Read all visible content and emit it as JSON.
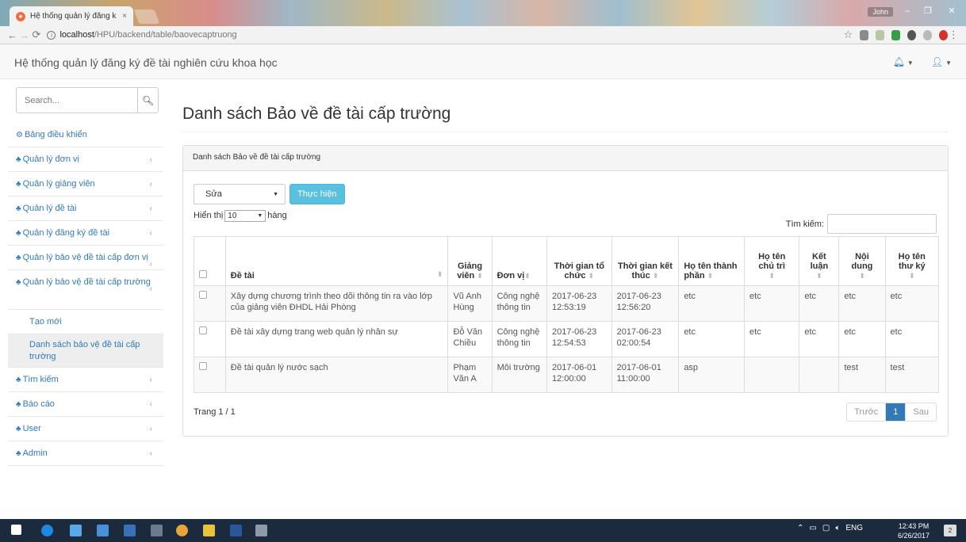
{
  "browser": {
    "tab_title": "Hệ thống quản lý đăng k",
    "tab_close": "×",
    "url_host": "localhost",
    "url_path": "/HPU/backend/table/baovecaptruong",
    "window_user": "John"
  },
  "navbar": {
    "brand": "Hệ thống quản lý đăng ký đề tài nghiên cứu khoa học"
  },
  "sidebar": {
    "search_placeholder": "Search...",
    "dashboard": "Bảng điều khiển",
    "items_top": [
      "Quản lý đơn vị",
      "Quản lý giảng viên",
      "Quản lý đề tài",
      "Quản lý đăng ký đề tài",
      "Quản lý bảo vệ đề tài cấp đơn vị"
    ],
    "current_group": "Quản lý bảo vệ đề tài cấp trường",
    "sub_create": "Tạo mới",
    "sub_list": "Danh sách bảo vệ đề tài cấp trường",
    "items_bottom": [
      "Tìm kiếm",
      "Báo cáo",
      "User",
      "Admin"
    ]
  },
  "main": {
    "page_title": "Danh sách Bảo về đề tài cấp trường",
    "panel_heading": "Danh sách Bảo về đề tài cấp trường",
    "action_selected": "Sửa",
    "execute_button": "Thực hiện",
    "show_label": "Hiển thị",
    "page_length": "10",
    "rows_label": "hàng",
    "search_label": "Tìm kiếm:",
    "page_info": "Trang 1 / 1",
    "pager": {
      "prev": "Trước",
      "current": "1",
      "next": "Sau"
    }
  },
  "table": {
    "headers": [
      "Đề tài",
      "Giảng viên",
      "Đơn vị",
      "Thời gian tổ chức",
      "Thời gian kết thúc",
      "Họ tên thành phần",
      "Họ tên chủ trì",
      "Kết luận",
      "Nội dung",
      "Họ tên thư ký"
    ],
    "rows": [
      [
        "Xây dựng chương trình theo dõi thông tin ra vào lớp của giảng viên ĐHDL Hải Phòng",
        "Vũ Anh Hùng",
        "Công nghệ thông tin",
        "2017-06-23 12:53:19",
        "2017-06-23 12:56:20",
        "etc",
        "etc",
        "etc",
        "etc",
        "etc"
      ],
      [
        "Đề tài xây dựng trang web quản lý nhân sự",
        "Đỗ Văn Chiều",
        "Công nghệ thông tin",
        "2017-06-23 12:54:53",
        "2017-06-23 02:00:54",
        "etc",
        "etc",
        "etc",
        "etc",
        "etc"
      ],
      [
        "Đề tài quản lý nước sạch",
        "Phạm Văn A",
        "Môi trường",
        "2017-06-01 12:00:00",
        "2017-06-01 11:00:00",
        "asp",
        "",
        "",
        "test",
        "test"
      ]
    ]
  },
  "taskbar": {
    "time": "12:43 PM",
    "date": "6/26/2017",
    "lang": "ENG"
  },
  "colors": {
    "link": "#337ab7",
    "info_button": "#5bc0de",
    "taskbar": "#1c2a3d"
  }
}
